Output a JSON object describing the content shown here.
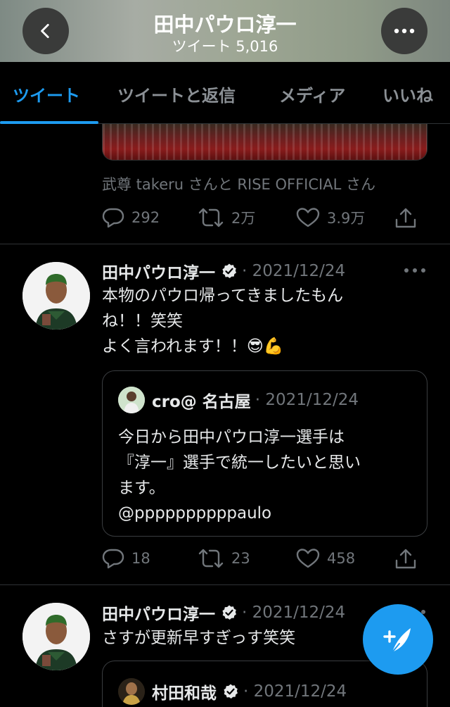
{
  "header": {
    "title": "田中パウロ淳一",
    "subtitle": "ツイート 5,016"
  },
  "tabs": [
    {
      "label": "ツイート",
      "active": true
    },
    {
      "label": "ツイートと返信",
      "active": false
    },
    {
      "label": "メディア",
      "active": false
    },
    {
      "label": "いいね",
      "active": false
    }
  ],
  "prev_tweet": {
    "tagged": "武尊 takeru さんと RISE OFFICIAL さん",
    "replies": "292",
    "retweets": "2万",
    "likes": "3.9万"
  },
  "tweets": [
    {
      "name": "田中パウロ淳一",
      "date": "· 2021/12/24",
      "lines": [
        "本物のパウロ帰ってきましたもん",
        "ね！！笑笑",
        "よく言われます！！😎💪"
      ],
      "quote": {
        "name": "cro@ 名古屋",
        "date": "· 2021/12/24",
        "lines": [
          "今日から田中パウロ淳一選手は",
          "『淳一』選手で統一したいと思い",
          "ます。",
          "@ppppppppppaulo"
        ]
      },
      "replies": "18",
      "retweets": "23",
      "likes": "458"
    },
    {
      "name": "田中パウロ淳一",
      "date": "· 2021/12/24",
      "lines": [
        "さすが更新早すぎっす笑笑"
      ],
      "quote": {
        "name": "村田和哉",
        "date": "· 2021/12/24"
      }
    }
  ],
  "colors": {
    "accent": "#1d9bf0",
    "muted": "#71767b",
    "background": "#000000"
  },
  "icons": [
    "back-icon",
    "more-icon",
    "reply-icon",
    "retweet-icon",
    "like-icon",
    "share-icon",
    "verified-icon",
    "compose-icon"
  ]
}
